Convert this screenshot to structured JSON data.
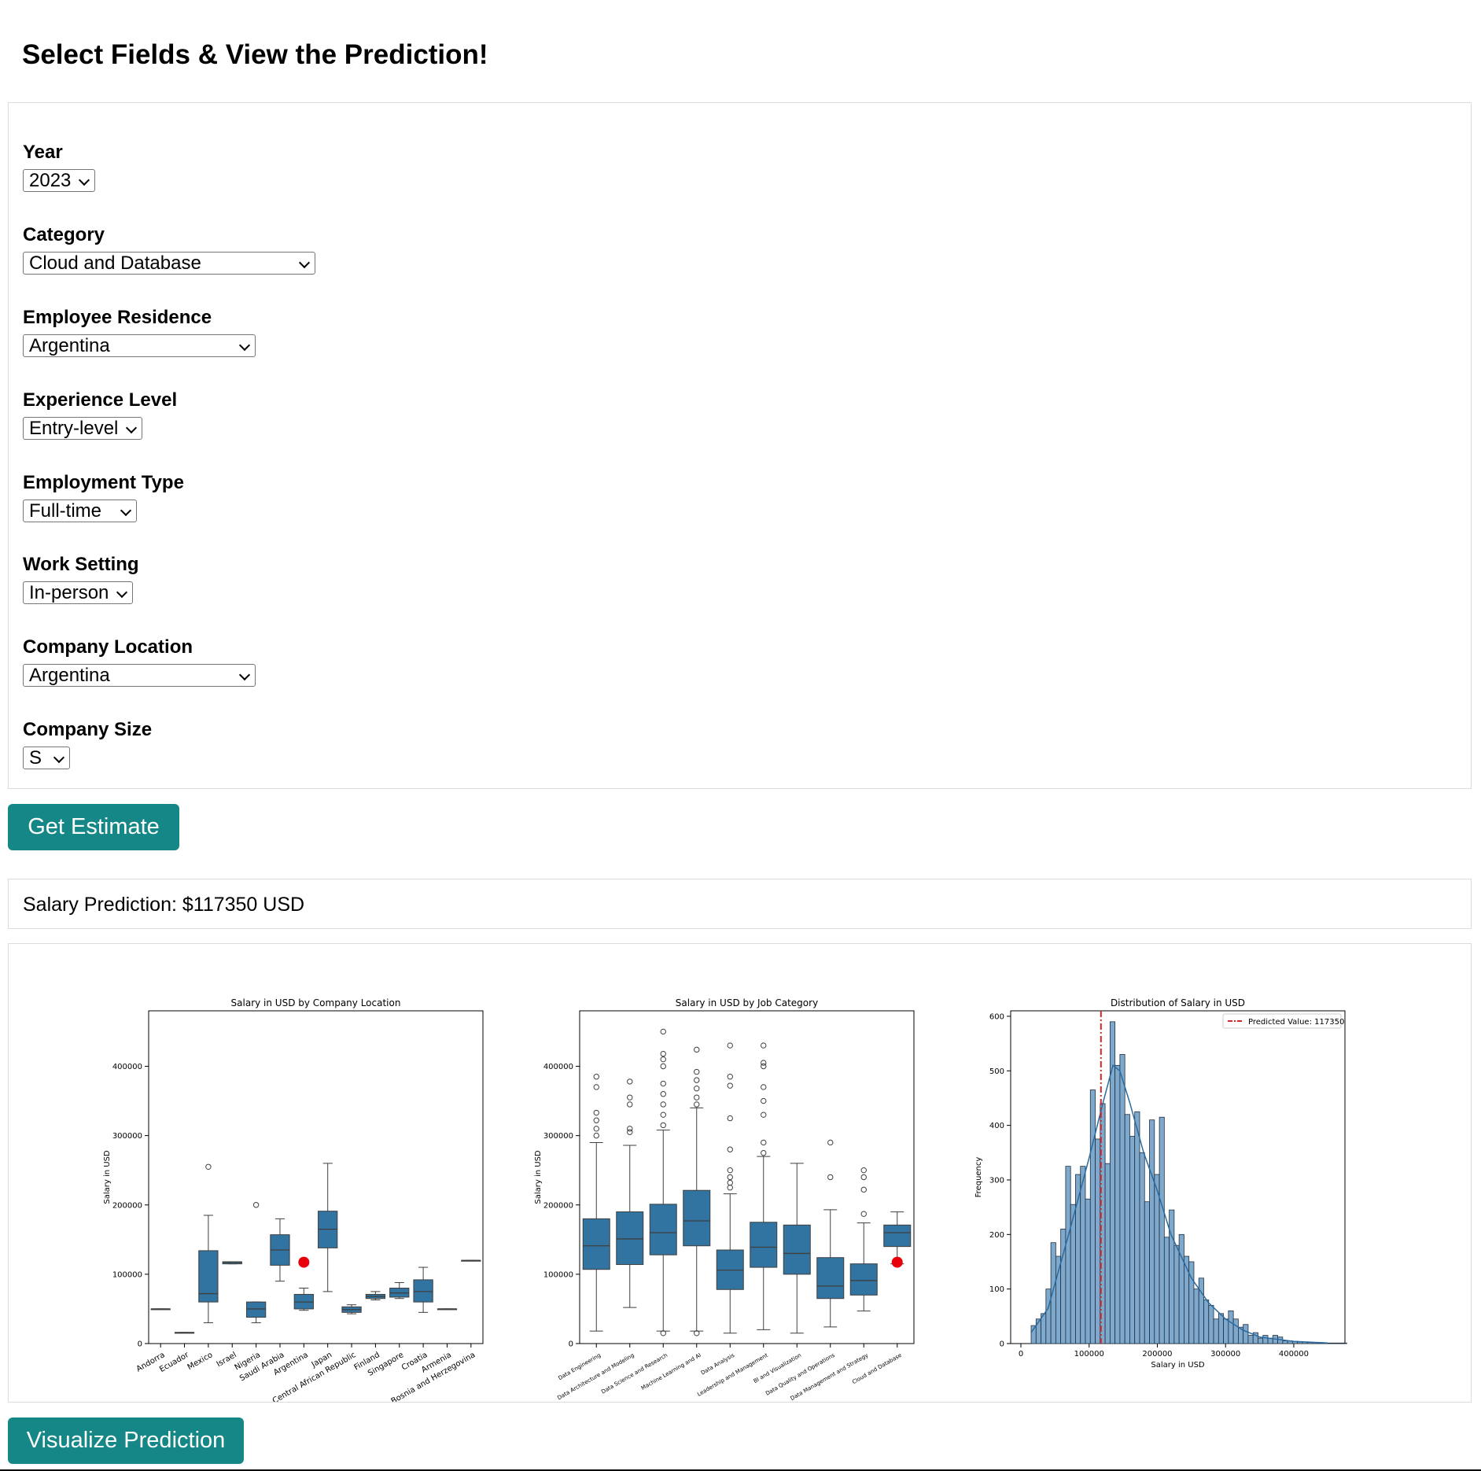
{
  "page_title": "Select Fields & View the Prediction!",
  "fields": [
    {
      "label": "Year",
      "value": "2023"
    },
    {
      "label": "Category",
      "value": "Cloud and Database"
    },
    {
      "label": "Employee Residence",
      "value": "Argentina"
    },
    {
      "label": "Experience Level",
      "value": "Entry-level"
    },
    {
      "label": "Employment Type",
      "value": "Full-time"
    },
    {
      "label": "Work Setting",
      "value": "In-person"
    },
    {
      "label": "Company Location",
      "value": "Argentina"
    },
    {
      "label": "Company Size",
      "value": "S"
    }
  ],
  "buttons": {
    "estimate": "Get Estimate",
    "visualize": "Visualize Prediction"
  },
  "prediction_text": "Salary Prediction: $117350 USD",
  "colors": {
    "accent": "#168787",
    "box": "#3274a1",
    "marker": "#e8000b",
    "hist": "#7fa9cc"
  },
  "chart_data": [
    {
      "type": "boxplot",
      "title": "Salary in USD by Company Location",
      "ylabel": "Salary in USD",
      "ylim": [
        0,
        480000
      ],
      "yticks": [
        0,
        100000,
        200000,
        300000,
        400000
      ],
      "categories": [
        "Andorra",
        "Ecuador",
        "Mexico",
        "Israel",
        "Nigeria",
        "Saudi Arabia",
        "Argentina",
        "Japan",
        "Central African Republic",
        "Finland",
        "Singapore",
        "Croatia",
        "Armenia",
        "Bosnia and Herzegovina"
      ],
      "boxes": [
        {
          "whislo": 50000,
          "q1": 50000,
          "med": 50000,
          "q3": 50000,
          "whishi": 50000,
          "fliers": []
        },
        {
          "whislo": 16000,
          "q1": 16000,
          "med": 16000,
          "q3": 16000,
          "whishi": 16000,
          "fliers": []
        },
        {
          "whislo": 30000,
          "q1": 60000,
          "med": 72000,
          "q3": 134000,
          "whishi": 185000,
          "fliers": [
            255000
          ]
        },
        {
          "whislo": 115000,
          "q1": 115000,
          "med": 117000,
          "q3": 118000,
          "whishi": 118000,
          "fliers": []
        },
        {
          "whislo": 30000,
          "q1": 38000,
          "med": 50000,
          "q3": 60000,
          "whishi": 60000,
          "fliers": [
            200000
          ]
        },
        {
          "whislo": 90000,
          "q1": 113000,
          "med": 135000,
          "q3": 157000,
          "whishi": 180000,
          "fliers": []
        },
        {
          "whislo": 48000,
          "q1": 50000,
          "med": 60000,
          "q3": 71000,
          "whishi": 80000,
          "fliers": []
        },
        {
          "whislo": 75000,
          "q1": 138000,
          "med": 165000,
          "q3": 191000,
          "whishi": 260000,
          "fliers": []
        },
        {
          "whislo": 43000,
          "q1": 45000,
          "med": 49000,
          "q3": 53000,
          "whishi": 56000,
          "fliers": []
        },
        {
          "whislo": 63000,
          "q1": 65000,
          "med": 68000,
          "q3": 71000,
          "whishi": 75000,
          "fliers": []
        },
        {
          "whislo": 65000,
          "q1": 67000,
          "med": 73000,
          "q3": 80000,
          "whishi": 88000,
          "fliers": []
        },
        {
          "whislo": 45000,
          "q1": 60000,
          "med": 75000,
          "q3": 92000,
          "whishi": 110000,
          "fliers": []
        },
        {
          "whislo": 50000,
          "q1": 50000,
          "med": 50000,
          "q3": 50000,
          "whishi": 50000,
          "fliers": []
        },
        {
          "whislo": 120000,
          "q1": 120000,
          "med": 120000,
          "q3": 120000,
          "whishi": 120000,
          "fliers": []
        }
      ],
      "highlight": {
        "category": "Argentina",
        "value": 117350
      }
    },
    {
      "type": "boxplot",
      "title": "Salary in USD by Job Category",
      "ylabel": "Salary in USD",
      "ylim": [
        0,
        480000
      ],
      "yticks": [
        0,
        100000,
        200000,
        300000,
        400000
      ],
      "categories": [
        "Data Engineering",
        "Data Architecture and Modeling",
        "Data Science and Research",
        "Machine Learning and AI",
        "Data Analysis",
        "Leadership and Management",
        "BI and Visualization",
        "Data Quality and Operations",
        "Data Management and Strategy",
        "Cloud and Database"
      ],
      "boxes": [
        {
          "whislo": 18000,
          "q1": 107000,
          "med": 141000,
          "q3": 180000,
          "whishi": 290000,
          "fliers": [
            300000,
            310000,
            322000,
            333000,
            370000,
            385000
          ]
        },
        {
          "whislo": 52000,
          "q1": 114000,
          "med": 151000,
          "q3": 190000,
          "whishi": 286000,
          "fliers": [
            305000,
            310000,
            345000,
            355000,
            378000
          ]
        },
        {
          "whislo": 18000,
          "q1": 128000,
          "med": 160000,
          "q3": 201000,
          "whishi": 308000,
          "fliers": [
            15000,
            315000,
            330000,
            345000,
            360000,
            375000,
            400000,
            410000,
            418000,
            450000
          ]
        },
        {
          "whislo": 18000,
          "q1": 141000,
          "med": 177000,
          "q3": 221000,
          "whishi": 340000,
          "fliers": [
            15000,
            345000,
            355000,
            368000,
            380000,
            392000,
            424000
          ]
        },
        {
          "whislo": 15000,
          "q1": 78000,
          "med": 106000,
          "q3": 135000,
          "whishi": 216000,
          "fliers": [
            225000,
            232000,
            240000,
            250000,
            280000,
            325000,
            372000,
            385000,
            430000
          ]
        },
        {
          "whislo": 20000,
          "q1": 110000,
          "med": 139000,
          "q3": 175000,
          "whishi": 270000,
          "fliers": [
            275000,
            290000,
            330000,
            350000,
            370000,
            400000,
            405000,
            430000
          ]
        },
        {
          "whislo": 15000,
          "q1": 100000,
          "med": 130000,
          "q3": 171000,
          "whishi": 260000,
          "fliers": []
        },
        {
          "whislo": 24000,
          "q1": 65000,
          "med": 83000,
          "q3": 124000,
          "whishi": 193000,
          "fliers": [
            240000,
            290000
          ]
        },
        {
          "whislo": 47000,
          "q1": 70000,
          "med": 91000,
          "q3": 115000,
          "whishi": 174000,
          "fliers": [
            187000,
            222000,
            240000,
            250000
          ]
        },
        {
          "whislo": 115000,
          "q1": 140000,
          "med": 160000,
          "q3": 171000,
          "whishi": 190000,
          "fliers": []
        }
      ],
      "highlight": {
        "category": "Cloud and Database",
        "value": 117350
      }
    },
    {
      "type": "histogram",
      "title": "Distribution of Salary in USD",
      "xlabel": "Salary in USD",
      "ylabel": "Frequency",
      "xlim": [
        -15000,
        475000
      ],
      "ylim": [
        0,
        610
      ],
      "xticks": [
        0,
        100000,
        200000,
        300000,
        400000
      ],
      "yticks": [
        0,
        100,
        200,
        300,
        400,
        500,
        600
      ],
      "bin_start": 15000,
      "bin_width": 7230,
      "counts": [
        33,
        45,
        55,
        100,
        185,
        160,
        210,
        325,
        255,
        310,
        325,
        265,
        465,
        375,
        440,
        330,
        590,
        510,
        530,
        420,
        380,
        425,
        350,
        260,
        410,
        310,
        415,
        195,
        245,
        180,
        200,
        160,
        150,
        100,
        120,
        80,
        70,
        45,
        55,
        45,
        60,
        45,
        30,
        35,
        15,
        20,
        10,
        15,
        10,
        15,
        12,
        5,
        5,
        4,
        3,
        3,
        2,
        2,
        2,
        1,
        1,
        1,
        1,
        1
      ],
      "kde": [
        [
          15000,
          20
        ],
        [
          40000,
          65
        ],
        [
          70000,
          200
        ],
        [
          100000,
          340
        ],
        [
          120000,
          440
        ],
        [
          135000,
          510
        ],
        [
          145000,
          500
        ],
        [
          160000,
          440
        ],
        [
          180000,
          350
        ],
        [
          200000,
          280
        ],
        [
          220000,
          200
        ],
        [
          250000,
          120
        ],
        [
          275000,
          75
        ],
        [
          300000,
          45
        ],
        [
          325000,
          25
        ],
        [
          350000,
          12
        ],
        [
          400000,
          4
        ],
        [
          450000,
          1
        ]
      ],
      "vline": 117350,
      "legend": "Predicted Value: 117350",
      "legend_position": "top-right"
    }
  ]
}
